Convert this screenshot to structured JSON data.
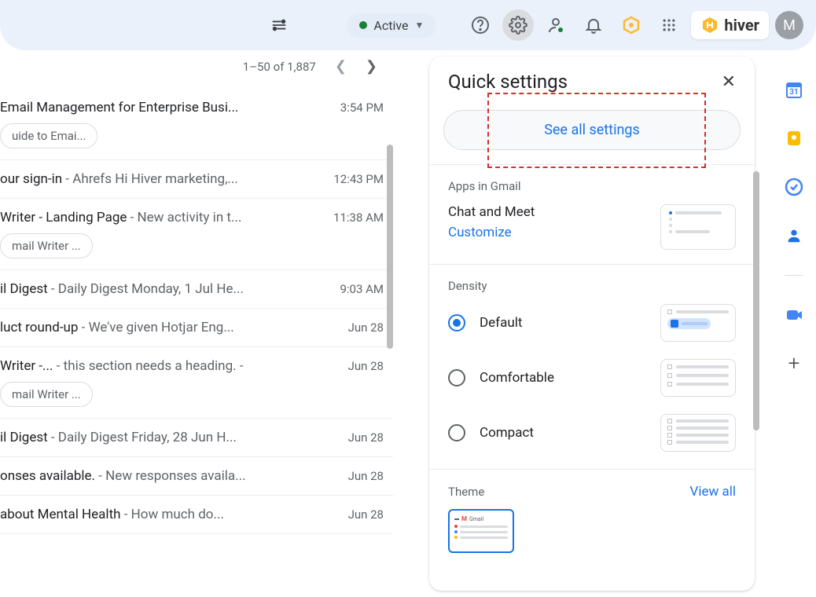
{
  "topbar": {
    "status_label": "Active",
    "hiver_label": "hiver",
    "avatar_letter": "M"
  },
  "pagination": {
    "range_text": "1–50 of 1,887"
  },
  "emails": [
    {
      "subject": "Email Management for Enterprise Busi...",
      "preview": "",
      "time": "3:54 PM",
      "chip": "uide to Emai..."
    },
    {
      "subject": "our sign-in",
      "preview": " - Ahrefs Hi Hiver marketing,...",
      "time": "12:43 PM"
    },
    {
      "subject": "Writer - Landing Page",
      "preview": " - New activity in t...",
      "time": "11:38 AM",
      "chip": "mail Writer ..."
    },
    {
      "subject": "il Digest",
      "preview": " - Daily Digest Monday, 1 Jul He...",
      "time": "9:03 AM"
    },
    {
      "subject": "luct round-up",
      "preview": " - We've given Hotjar Eng...",
      "time": "Jun 28"
    },
    {
      "subject": "Writer -...",
      "preview": " - this section needs a heading. -",
      "time": "Jun 28",
      "chip": "mail Writer ..."
    },
    {
      "subject": "il Digest",
      "preview": " - Daily Digest Friday, 28 Jun H...",
      "time": "Jun 28"
    },
    {
      "subject": "onses available.",
      "preview": " - New responses availa...",
      "time": "Jun 28"
    },
    {
      "subject": "about Mental Health",
      "preview": " - How much do...",
      "time": "Jun 28"
    }
  ],
  "settings": {
    "title": "Quick settings",
    "see_all": "See all settings",
    "apps_label": "Apps in Gmail",
    "chat_meet": "Chat and Meet",
    "customize": "Customize",
    "density_label": "Density",
    "density": {
      "default": "Default",
      "comfortable": "Comfortable",
      "compact": "Compact"
    },
    "theme_label": "Theme",
    "view_all": "View all"
  }
}
